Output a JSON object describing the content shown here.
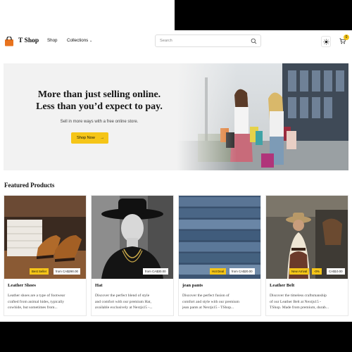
{
  "header": {
    "brand": "T Shop",
    "nav_shop": "Shop",
    "nav_collections": "Collections",
    "search_placeholder": "Search",
    "cart_count": "0"
  },
  "hero": {
    "title_line1": "More than just selling online.",
    "title_line2": "Less than you’d expect to pay.",
    "subtitle": "Sell in more ways with a free online store.",
    "button_label": "Shop Now",
    "button_arrow": "→"
  },
  "featured": {
    "title": "Featured Products",
    "products": [
      {
        "name": "Leather Shoes",
        "desc_line1": "Leather shoes are a type of footwear",
        "desc_line2": "crafted from animal hides, typically",
        "desc_line3": "cowhide, but sometimes from...",
        "tag1": "Best Seller",
        "tag2": "",
        "price": "from CA$290.00"
      },
      {
        "name": "Hat",
        "desc_line1": "Discover the perfect blend of style",
        "desc_line2": "and comfort with our premium Hat,",
        "desc_line3": "available exclusively at Nextjs15 -...",
        "tag1": "",
        "tag2": "",
        "price": "from CA$30.00"
      },
      {
        "name": "jean pants",
        "desc_line1": "Discover the perfect fusion of",
        "desc_line2": "comfort and style with our premium",
        "desc_line3": "jean pants at Nextjs15 - TShop...",
        "tag1": "Hot Deal",
        "tag2": "",
        "price": "from CA$20.00"
      },
      {
        "name": "Leather Belt",
        "desc_line1": "Discover the timeless craftsmanship",
        "desc_line2": "of our Leather Belt at Nextjs15 -",
        "desc_line3": "TShop. Made from premium, durab...",
        "tag1": "New Arrival",
        "tag2": "-0%",
        "price": "CA$10.00"
      }
    ]
  }
}
